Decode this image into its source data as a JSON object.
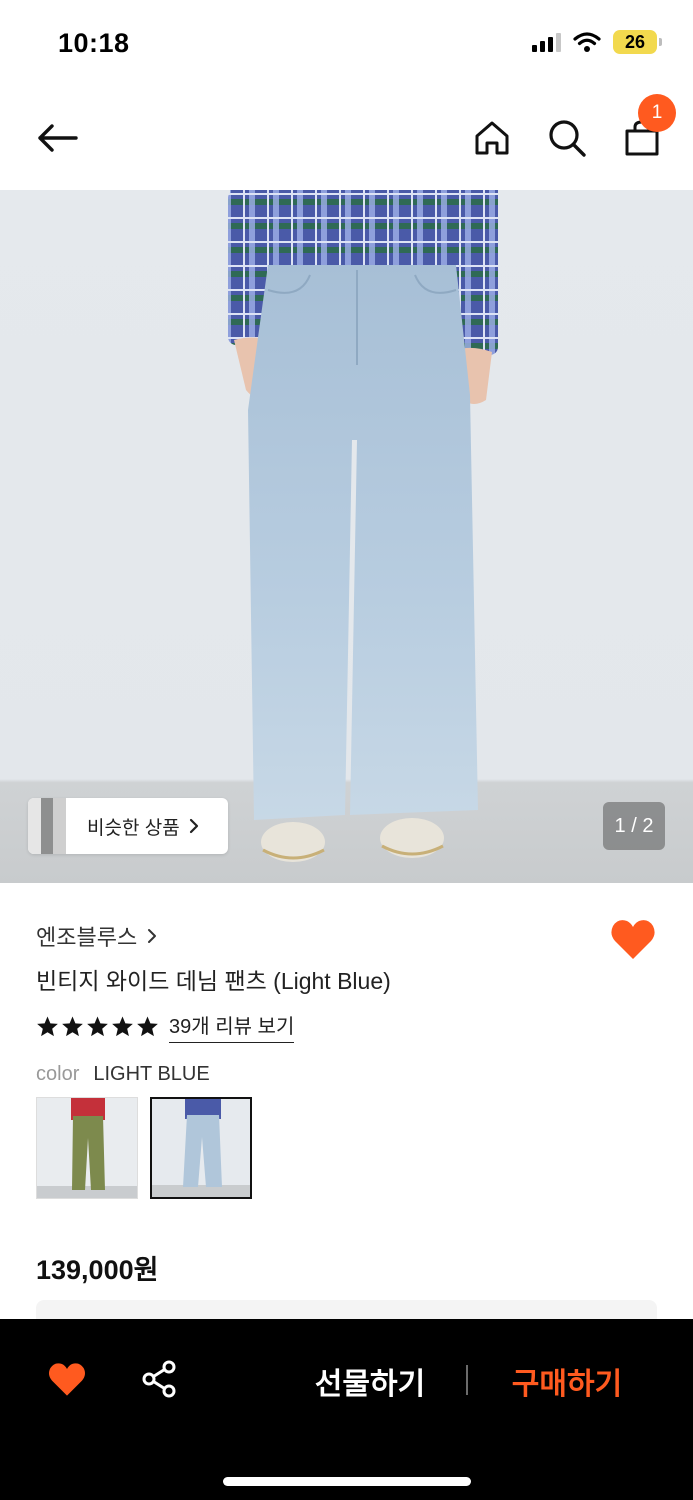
{
  "status_bar": {
    "time": "10:18",
    "battery": "26"
  },
  "header": {
    "back_icon": "arrow-left-icon",
    "home_icon": "home-icon",
    "search_icon": "search-icon",
    "cart_icon": "shopping-bag-icon",
    "cart_count": "1"
  },
  "gallery": {
    "similar_label": "비슷한 상품",
    "page_indicator": "1 / 2"
  },
  "product": {
    "brand": "엔조블루스",
    "title": "빈티지 와이드 데님 팬츠 (Light Blue)",
    "rating": 5,
    "review_link": "39개 리뷰 보기",
    "color_label": "color",
    "color_value": "LIGHT BLUE",
    "price": "139,000원",
    "liked": true
  },
  "bottom_bar": {
    "gift_label": "선물하기",
    "buy_label": "구매하기"
  },
  "colors": {
    "accent": "#ff5a1f",
    "bar_bg": "#000000"
  }
}
